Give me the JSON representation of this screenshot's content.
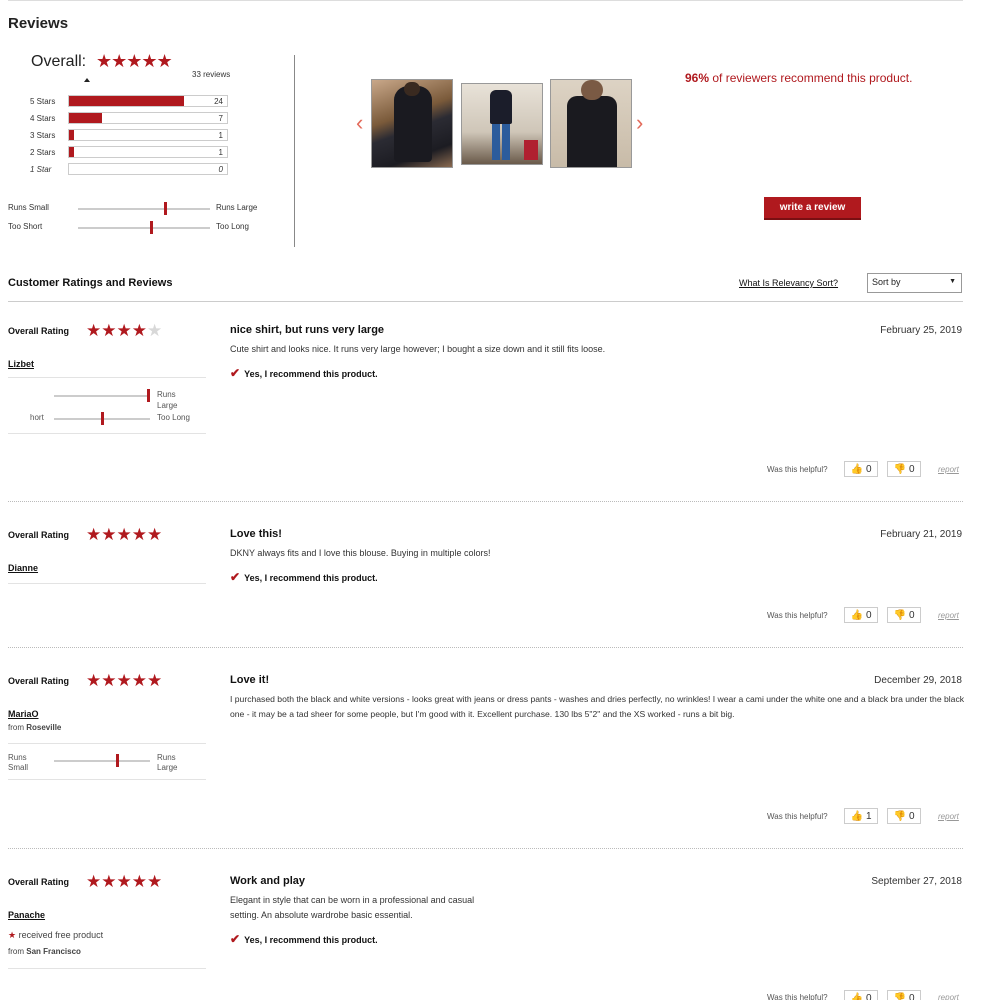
{
  "page_title": "Reviews",
  "summary": {
    "overall_label": "Overall:",
    "stars": "★★★★★",
    "review_count": "33 reviews",
    "bars": [
      {
        "label": "5 Stars",
        "count": "24",
        "fraction": 0.73
      },
      {
        "label": "4 Stars",
        "count": "7",
        "fraction": 0.21
      },
      {
        "label": "3 Stars",
        "count": "1",
        "fraction": 0.03
      },
      {
        "label": "2 Stars",
        "count": "1",
        "fraction": 0.03
      },
      {
        "label": "1 Star",
        "count": "0",
        "fraction": 0
      }
    ],
    "fit_sliders": [
      {
        "left": "Runs Small",
        "right": "Runs Large",
        "value": 0.67
      },
      {
        "left": "Too Short",
        "right": "Too Long",
        "value": 0.56
      }
    ]
  },
  "gallery": {
    "prev_icon": "chevron-left",
    "next_icon": "chevron-right"
  },
  "recommend": {
    "percent": "96%",
    "text": " of reviewers recommend this product."
  },
  "write_review_label": "write a review",
  "section_heading": "Customer Ratings and Reviews",
  "relevancy_link": "What Is Relevancy Sort?",
  "sort_select": {
    "selected": "Sort by"
  },
  "overall_rating_label": "Overall Rating",
  "recommend_label": "Yes, I recommend this product.",
  "helpful_label": "Was this helpful?",
  "report_label": "report",
  "reviews": [
    {
      "stars_on": "★★★★",
      "stars_off": "★",
      "user": "Lizbet",
      "title": "nice shirt, but runs very large",
      "date": "February 25, 2019",
      "body": "Cute shirt and looks nice. It runs very large however; I bought a size down and it still fits loose.",
      "yes": "0",
      "no": "0",
      "slider1_left": "",
      "slider1_right": "Runs\nLarge",
      "slider1_value": 1.0,
      "slider2_left": "hort",
      "slider2_right": "Too Long",
      "slider2_value": 0.5
    },
    {
      "stars_on": "★★★★★",
      "user": "Dianne",
      "title": "Love this!",
      "date": "February 21, 2019",
      "body": "DKNY always fits and I love this blouse. Buying in multiple colors!",
      "yes": "0",
      "no": "0"
    },
    {
      "stars_on": "★★★★★",
      "user": "MariaO",
      "from_label": "from ",
      "location": "Roseville",
      "title": "Love it!",
      "date": "December 29, 2018",
      "body": "I purchased both the black and white versions - looks great with jeans or dress pants - washes and dries perfectly, no wrinkles! I wear a cami under the white one and a black bra under the black one - it may be a tad sheer for some people, but I'm good with it. Excellent purchase. 130 lbs 5\"2\" and the XS worked - runs a bit big.",
      "yes": "1",
      "no": "0",
      "slider1_left": "Runs Small",
      "slider1_right": "Runs Large",
      "slider1_value": 0.67
    },
    {
      "stars_on": "★★★★★",
      "user": "Panache",
      "free_product": "received free product",
      "from_label": "from ",
      "location": "San Francisco",
      "title": "Work and play",
      "date": "September 27, 2018",
      "body": "Elegant in style that can be worn in a professional and casual setting. An absolute wardrobe basic essential.",
      "yes": "0",
      "no": "0"
    }
  ]
}
